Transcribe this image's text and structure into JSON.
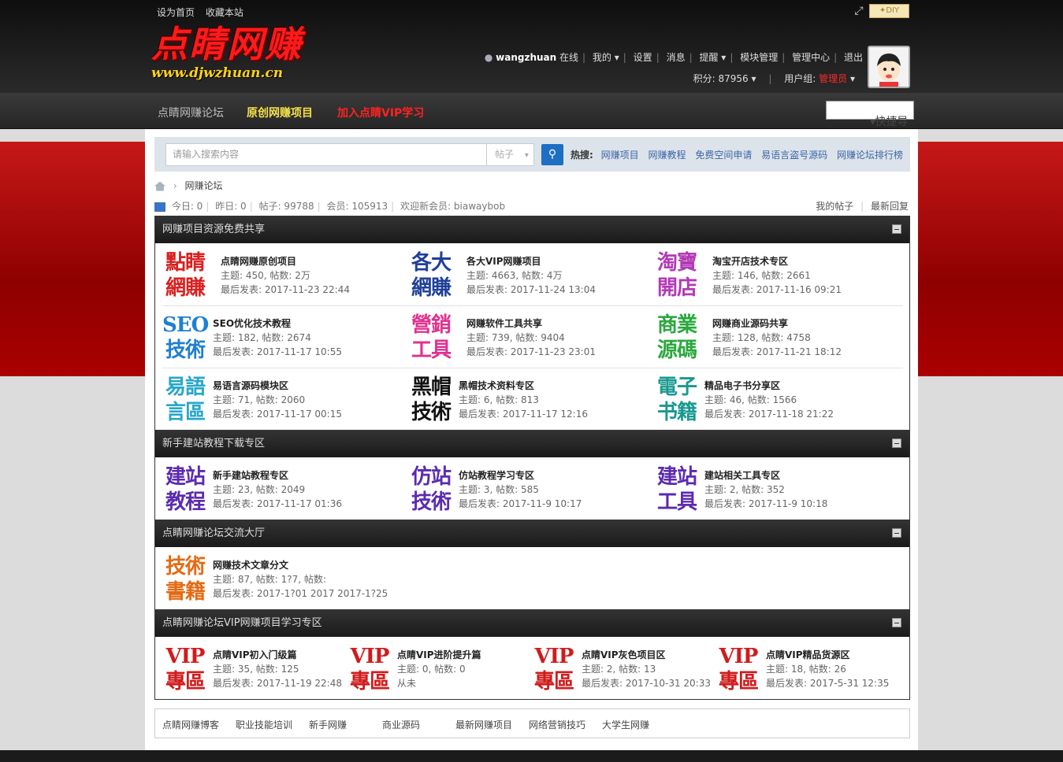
{
  "top": {
    "set_home": "设为首页",
    "bookmark": "收藏本站",
    "diy": "DIY"
  },
  "logo": {
    "line1": "点睛网赚",
    "line2": "www.djwzhuan.cn"
  },
  "user": {
    "name": "wangzhuan",
    "status": "在线",
    "my": "我的",
    "settings": "设置",
    "messages": "消息",
    "reminders": "提醒",
    "module_manage": "模块管理",
    "admin_center": "管理中心",
    "logout": "退出",
    "points_label": "积分: 87956",
    "group_label": "用户组:",
    "group_value": "管理员"
  },
  "nav": {
    "items": [
      "点睛网赚论坛",
      "原创网赚项目",
      "加入点睛VIP学习"
    ],
    "colors": [
      "#bbbbbb",
      "#f5e04a",
      "#ff2222"
    ],
    "quick": "快捷导航"
  },
  "search": {
    "placeholder": "请输入搜索内容",
    "type": "帖子",
    "hot_label": "热搜:",
    "hot": [
      "网赚项目",
      "网赚教程",
      "免费空间申请",
      "易语言盗号源码",
      "网赚论坛排行榜"
    ]
  },
  "crumb": {
    "current": "网赚论坛"
  },
  "stats": {
    "today": "今日: 0",
    "yesterday": "昨日: 0",
    "posts": "帖子: 99788",
    "members": "会员: 105913",
    "welcome": "欢迎新会员:",
    "new_member": "biawaybob",
    "my_posts": "我的帖子",
    "latest": "最新回复"
  },
  "sections": [
    {
      "title": "网赚项目资源免费共享",
      "forums": [
        {
          "icon": [
            "點睛",
            "網賺"
          ],
          "color": "#d92020",
          "name": "点睛网赚原创项目",
          "meta": "主题: 450, 帖数: 2万",
          "last": "最后发表: 2017-11-23 22:44"
        },
        {
          "icon": [
            "各大",
            "網賺"
          ],
          "color": "#1f3f99",
          "name": "各大VIP网赚项目",
          "meta": "主题: 4663, 帖数: 4万",
          "last": "最后发表: 2017-11-24 13:04"
        },
        {
          "icon": [
            "淘寶",
            "開店"
          ],
          "color": "#b339b5",
          "name": "淘宝开店技术专区",
          "meta": "主题: 146, 帖数: 2661",
          "last": "最后发表: 2017-11-16 09:21"
        },
        {
          "icon": [
            "SEO",
            "技術"
          ],
          "color": "#1f7fd1",
          "name": "SEO优化技术教程",
          "meta": "主题: 182, 帖数: 2674",
          "last": "最后发表: 2017-11-17 10:55"
        },
        {
          "icon": [
            "營銷",
            "工具"
          ],
          "color": "#e0318f",
          "name": "网赚软件工具共享",
          "meta": "主题: 739, 帖数: 9404",
          "last": "最后发表: 2017-11-23 23:01"
        },
        {
          "icon": [
            "商業",
            "源碼"
          ],
          "color": "#2aa83d",
          "name": "网赚商业源码共享",
          "meta": "主题: 128, 帖数: 4758",
          "last": "最后发表: 2017-11-21 18:12"
        },
        {
          "icon": [
            "易語",
            "言區"
          ],
          "color": "#27a7c9",
          "name": "易语言源码模块区",
          "meta": "主题: 71, 帖数: 2060",
          "last": "最后发表: 2017-11-17 00:15"
        },
        {
          "icon": [
            "黑帽",
            "技術"
          ],
          "color": "#111111",
          "name": "黑帽技术资料专区",
          "meta": "主题: 6, 帖数: 813",
          "last": "最后发表: 2017-11-17 12:16"
        },
        {
          "icon": [
            "電子",
            "书籍"
          ],
          "color": "#19998f",
          "name": "精品电子书分享区",
          "meta": "主题: 46, 帖数: 1566",
          "last": "最后发表: 2017-11-18 21:22"
        }
      ]
    },
    {
      "title": "新手建站教程下载专区",
      "forums": [
        {
          "icon": [
            "建站",
            "教程"
          ],
          "color": "#5b2bb0",
          "name": "新手建站教程专区",
          "meta": "主题: 23, 帖数: 2049",
          "last": "最后发表: 2017-11-17 01:36"
        },
        {
          "icon": [
            "仿站",
            "技術"
          ],
          "color": "#5b2bb0",
          "name": "仿站教程学习专区",
          "meta": "主题: 3, 帖数: 585",
          "last": "最后发表: 2017-11-9 10:17"
        },
        {
          "icon": [
            "建站",
            "工具"
          ],
          "color": "#5b2bb0",
          "name": "建站相关工具专区",
          "meta": "主题: 2, 帖数: 352",
          "last": "最后发表: 2017-11-9 10:18"
        }
      ]
    },
    {
      "title": "点睛网赚论坛交流大厅",
      "forums": [
        {
          "icon": [
            "技術",
            "書籍"
          ],
          "color": "#e46a14",
          "name": "网赚技术文章分文",
          "meta": "主题: 87, 帖数: 1?7, 帖数:",
          "last": "最后发表: 2017-1?01 2017 2017-1?25"
        }
      ]
    },
    {
      "title": "点睛网赚论坛VIP网赚项目学习专区",
      "forums": [
        {
          "icon": [
            "VIP",
            "專區"
          ],
          "color": "#d01c1c",
          "name": "点睛VIP初入门级篇",
          "meta": "主题: 35, 帖数: 125",
          "last": "最后发表: 2017-11-19 22:48"
        },
        {
          "icon": [
            "VIP",
            "專區"
          ],
          "color": "#d01c1c",
          "name": "点睛VIP进阶提升篇",
          "meta": "主题: 0, 帖数: 0",
          "last": "从未"
        },
        {
          "icon": [
            "VIP",
            "專區"
          ],
          "color": "#d01c1c",
          "name": "点睛VIP灰色项目区",
          "meta": "主题: 2, 帖数: 13",
          "last": "最后发表: 2017-10-31 20:33"
        },
        {
          "icon": [
            "VIP",
            "專區"
          ],
          "color": "#d01c1c",
          "name": "点睛VIP精品货源区",
          "meta": "主题: 18, 帖数: 26",
          "last": "最后发表: 2017-5-31 12:35"
        }
      ]
    }
  ],
  "footer": {
    "links": [
      "点睛网赚博客",
      "职业技能培训",
      "新手网赚",
      "商业源码",
      "最新网赚项目",
      "网络营销技巧",
      "大学生网赚"
    ]
  }
}
